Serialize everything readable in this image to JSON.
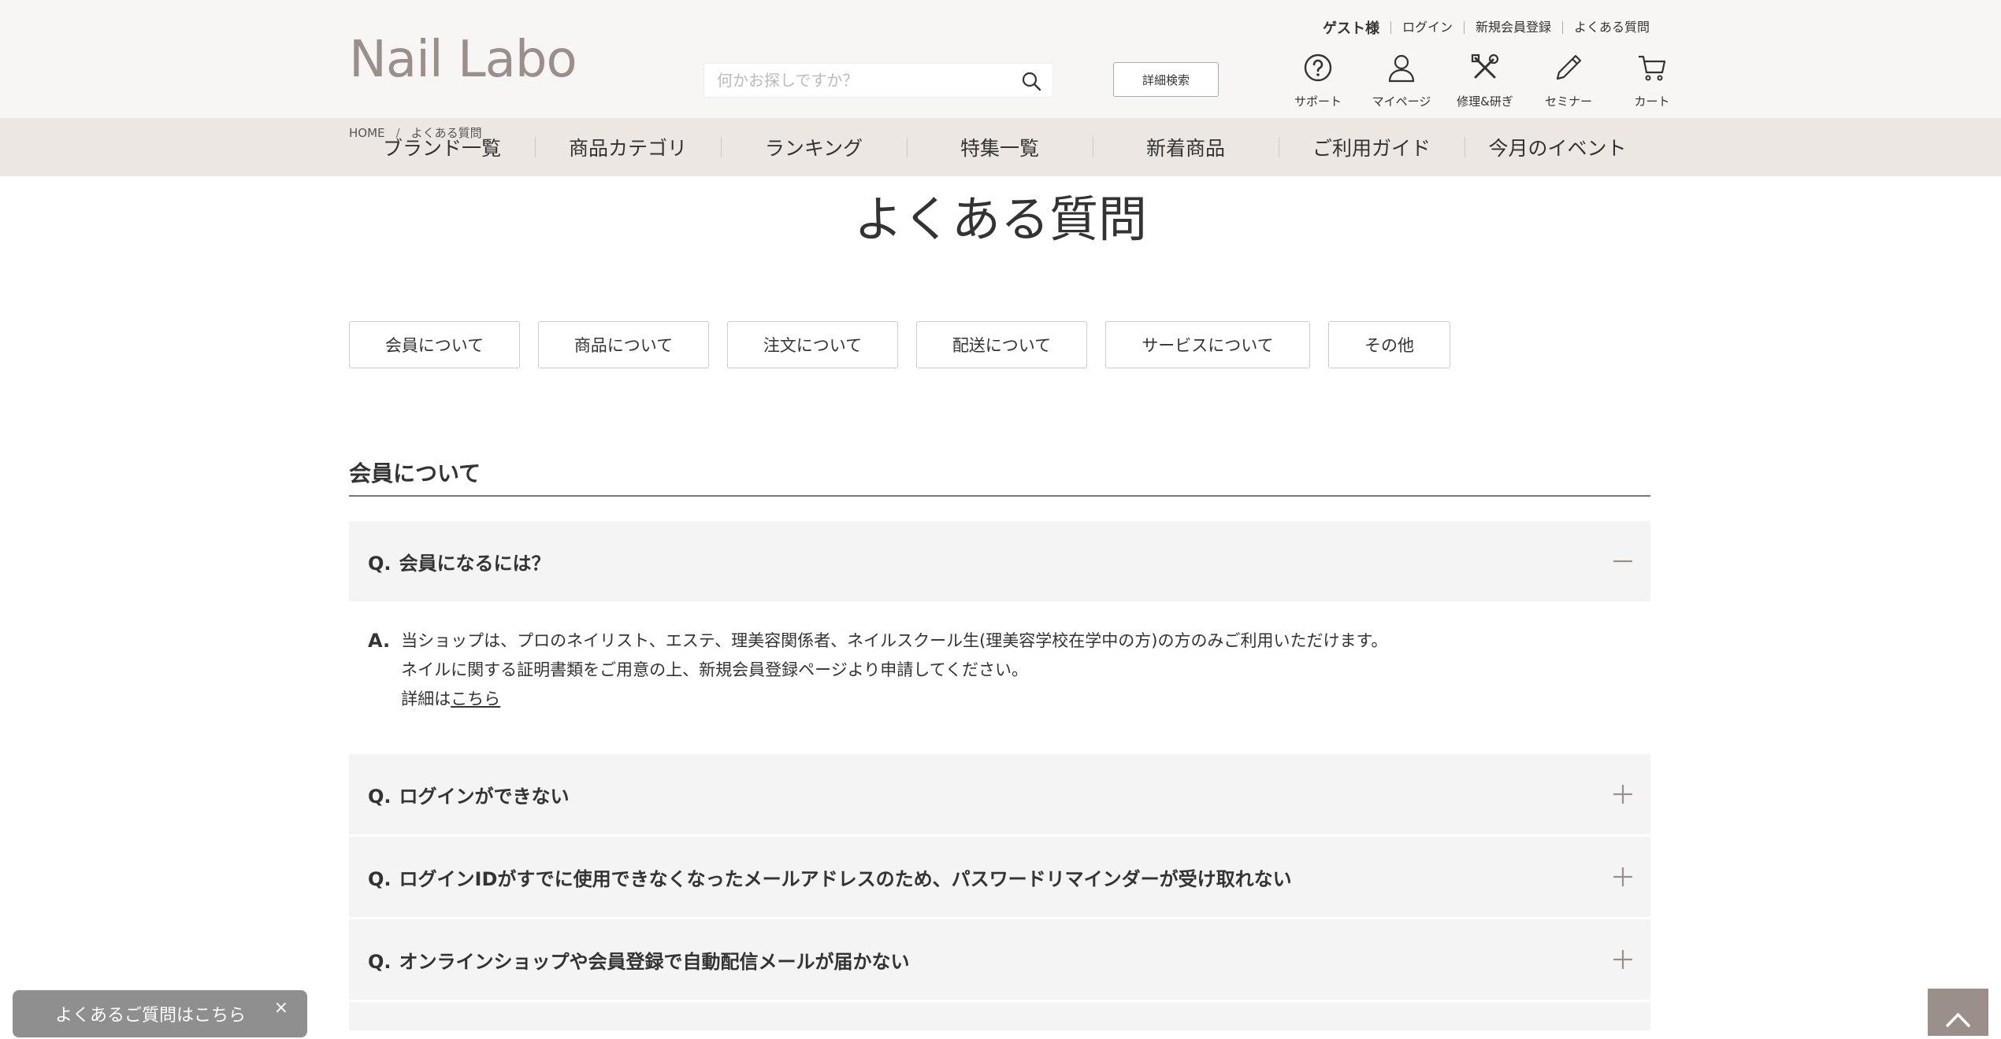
{
  "header": {
    "logo_text": "Nail Labo",
    "guest_label": "ゲスト様",
    "top_links": [
      "ログイン",
      "新規会員登録",
      "よくある質問"
    ],
    "search_placeholder": "何かお探しですか？",
    "advanced_search": "詳細検索",
    "utilities": [
      {
        "label": "サポート",
        "icon": "question-circle-icon"
      },
      {
        "label": "マイページ",
        "icon": "user-icon"
      },
      {
        "label": "修理&研ぎ",
        "icon": "tools-icon"
      },
      {
        "label": "セミナー",
        "icon": "pen-icon"
      },
      {
        "label": "カート",
        "icon": "cart-icon"
      }
    ]
  },
  "nav": {
    "items": [
      "ブランド一覧",
      "商品カテゴリ",
      "ランキング",
      "特集一覧",
      "新着商品",
      "ご利用ガイド",
      "今月のイベント"
    ]
  },
  "breadcrumb": {
    "home": "HOME",
    "separator": "/",
    "current": "よくある質問"
  },
  "page": {
    "title": "よくある質問"
  },
  "categories": [
    "会員について",
    "商品について",
    "注文について",
    "配送について",
    "サービスについて",
    "その他"
  ],
  "section": {
    "title": "会員について",
    "q_prefix": "Q.",
    "a_prefix": "A.",
    "questions": [
      {
        "text": "会員になるには？",
        "expanded": true
      },
      {
        "text": "ログインができない",
        "expanded": false
      },
      {
        "text": "ログインIDがすでに使用できなくなったメールアドレスのため、パスワードリマインダーが受け取れない",
        "expanded": false
      },
      {
        "text": "オンラインショップや会員登録で自動配信メールが届かない",
        "expanded": false
      }
    ],
    "answer": {
      "line1": "当ショップは、プロのネイリスト、エステ、理美容関係者、ネイルスクール生(理美容学校在学中の方)の方のみご利用いただけます。",
      "line2": "ネイルに関する証明書類をご用意の上、新規会員登録ページより申請してください。",
      "line3_prefix": "詳細は",
      "line3_link": "こちら"
    }
  },
  "floating": {
    "faq_banner": "よくあるご質問はこちら",
    "close": "×"
  },
  "colors": {
    "header_bg": "#f8f6f4",
    "nav_bg": "#ece7e3",
    "brand": "#9a8f8a",
    "qa_bg": "#f4f4f4"
  }
}
